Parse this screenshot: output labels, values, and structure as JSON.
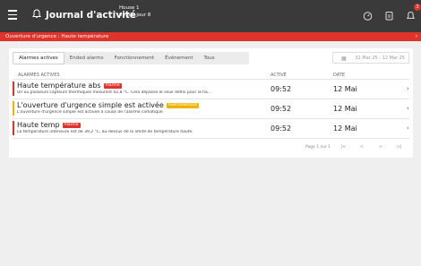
{
  "header": {
    "title": "Journal d'activité",
    "house": "House 1",
    "time": "09:52, jour 8",
    "notification_count": "3",
    "icons": [
      "menu-icon",
      "bell-icon",
      "gauge-icon",
      "clipboard-icon",
      "notification-bell-icon"
    ]
  },
  "alert_banner": {
    "text": "Ouverture d'urgence : Haute température",
    "color": "#e0332b"
  },
  "tabs": [
    {
      "label": "Alarmes actives"
    },
    {
      "label": "Ended alarms"
    },
    {
      "label": "Fonctionnement"
    },
    {
      "label": "Événement"
    },
    {
      "label": "Tous"
    }
  ],
  "date_range": "31 Mar 25 - 12 Mar 25",
  "columns": {
    "name": "ALARMES ACTIVES",
    "activated": "ACTIVÉ",
    "date": "DATE"
  },
  "rows": [
    {
      "name": "Haute température abs",
      "badge": "Alarme",
      "badge_color": "#e0332b",
      "description": "Un ou plusieurs capteurs thermiques mesurent 42,8 °C. Cela dépasse le seuil défini pour la ha...",
      "time": "09:52",
      "date": "12 Mai"
    },
    {
      "name": "L'ouverture d'urgence simple est activée",
      "badge": "Avertissement",
      "badge_color": "#f0b400",
      "description": "L'ouverture d'urgence simple est activée à cause de l'alarme climatique",
      "time": "09:52",
      "date": "12 Mai"
    },
    {
      "name": "Haute temp",
      "badge": "Alarme",
      "badge_color": "#e0332b",
      "description": "La température intérieure est de 39,2 °C, au-dessus de la limite de température haute.",
      "time": "09:52",
      "date": "12 Mai"
    }
  ],
  "pagination": {
    "label": "Page 1 sur 1",
    "first": "|<",
    "prev": "<",
    "next": ">",
    "last": ">|"
  }
}
